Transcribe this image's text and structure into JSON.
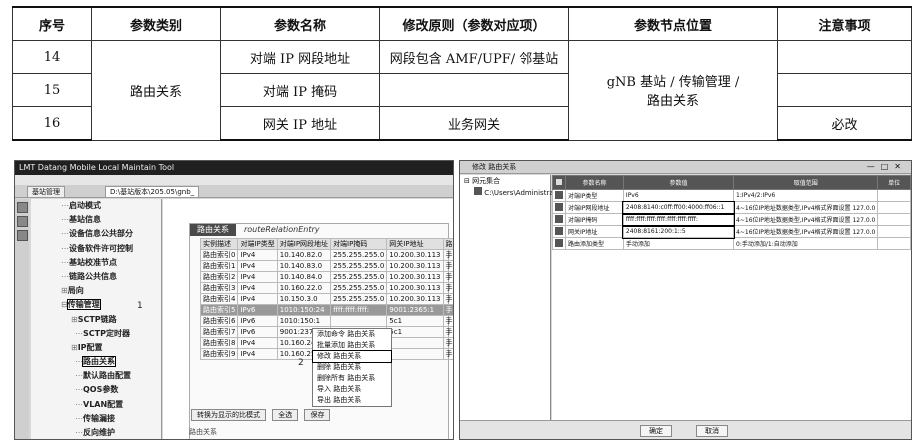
{
  "spec_table": {
    "headers": [
      "序号",
      "参数类别",
      "参数名称",
      "修改原则（参数对应项）",
      "参数节点位置",
      "注意事项"
    ],
    "rows": [
      {
        "no": "14",
        "name": "对端 IP 网段地址",
        "rule": "网段包含 AMF/UPF/ 邻基站",
        "note": ""
      },
      {
        "no": "15",
        "name": "对端 IP 掩码",
        "rule": "",
        "note": ""
      },
      {
        "no": "16",
        "name": "网关 IP 地址",
        "rule": "业务网关",
        "note": "必改"
      }
    ],
    "category": "路由关系",
    "location_line1": "gNB 基站 / 传输管理 /",
    "location_line2": "路由关系"
  },
  "lmt": {
    "title": "LMT Datang Mobile Local Maintain Tool",
    "tab_mgmt": "基站管理",
    "tab_file": "D:\\基站版本\\205.05\\gnb_",
    "tree": [
      "启动模式",
      "基站信息",
      "设备信息公共部分",
      "设备软件许可控制",
      "基站校准节点",
      "链路公共信息",
      "局向",
      "传输管理",
      "SCTP链路",
      "SCTP定时器",
      "IP配置",
      "路由关系",
      "默认路由配置",
      "QOS参数",
      "VLAN配置",
      "传输漏接",
      "反向维护"
    ],
    "marker1": "1",
    "marker2": "2",
    "panel_label": "路由关系",
    "panel_entry": "routeRelationEntry",
    "columns": [
      "实例描述",
      "对端IP类型",
      "对端IP网段地址",
      "对端IP掩码",
      "网关IP地址",
      "路由添加类型"
    ],
    "rows": [
      [
        "路由索引0",
        "IPv4",
        "10.140.82.0",
        "255.255.255.0",
        "10.200.30.113",
        "手动添加"
      ],
      [
        "路由索引1",
        "IPv4",
        "10.140.83.0",
        "255.255.255.0",
        "10.200.30.113",
        "手动添加"
      ],
      [
        "路由索引2",
        "IPv4",
        "10.140.84.0",
        "255.255.255.0",
        "10.200.30.113",
        "手动添加"
      ],
      [
        "路由索引3",
        "IPv4",
        "10.160.22.0",
        "255.255.255.0",
        "10.200.30.113",
        "手动添加"
      ],
      [
        "路由索引4",
        "IPv4",
        "10.150.3.0",
        "255.255.255.0",
        "10.200.30.113",
        "手动添加"
      ],
      [
        "路由索引5",
        "IPv6",
        "1010:150:24",
        "ffff:ffff:ffff:",
        "9001:2365:1",
        "手动添加"
      ],
      [
        "路由索引6",
        "IPv6",
        "1010:150:1",
        "",
        "5c1",
        "手动添加"
      ],
      [
        "路由索引7",
        "IPv6",
        "9001:2375",
        "",
        "5c1",
        "手动添加"
      ],
      [
        "路由索引8",
        "IPv4",
        "10.160.24.0",
        "",
        "",
        "手动添加"
      ],
      [
        "路由索引9",
        "IPv4",
        "10.160.25.0",
        "",
        "",
        "手动添加"
      ]
    ],
    "context_menu": [
      "添加命令 路由关系",
      "批量添加 路由关系",
      "修改 路由关系",
      "删除 路由关系",
      "删除所有 路由关系",
      "导入 路由关系",
      "导出 路由关系"
    ],
    "buttons": [
      "转换为显示的比模式",
      "全选",
      "保存"
    ],
    "below_label": "路由关系"
  },
  "dialog": {
    "title": "修改 路由关系",
    "tree_root": "网元集合",
    "tree_child": "C:\\Users\\Administrat",
    "columns": [
      "参数名称",
      "参数值",
      "取值范围",
      "单位"
    ],
    "rows": [
      [
        "对端IP类型",
        "IPv6",
        "1:IPv4/2:IPv6",
        ""
      ],
      [
        "对端IP网段地址",
        "2408:8140:c0ff:ff00:4000:ff06::1",
        "4~16位IP地址数据类型,IPv4格式界面设置 127.0.0",
        ""
      ],
      [
        "对端IP掩码",
        "ffff:ffff:ffff:ffff:ffff:ffff:ffff:",
        "4~16位IP地址数据类型,IPv4格式界面设置 127.0.0",
        ""
      ],
      [
        "网关IP地址",
        "2408:8161:200:1::5",
        "4~16位IP地址数据类型,IPv4格式界面设置 127.0.0",
        ""
      ],
      [
        "路由添加类型",
        "手动添加",
        "0:手动添加/1:自动添加",
        ""
      ]
    ],
    "ok": "确定",
    "cancel": "取消"
  }
}
